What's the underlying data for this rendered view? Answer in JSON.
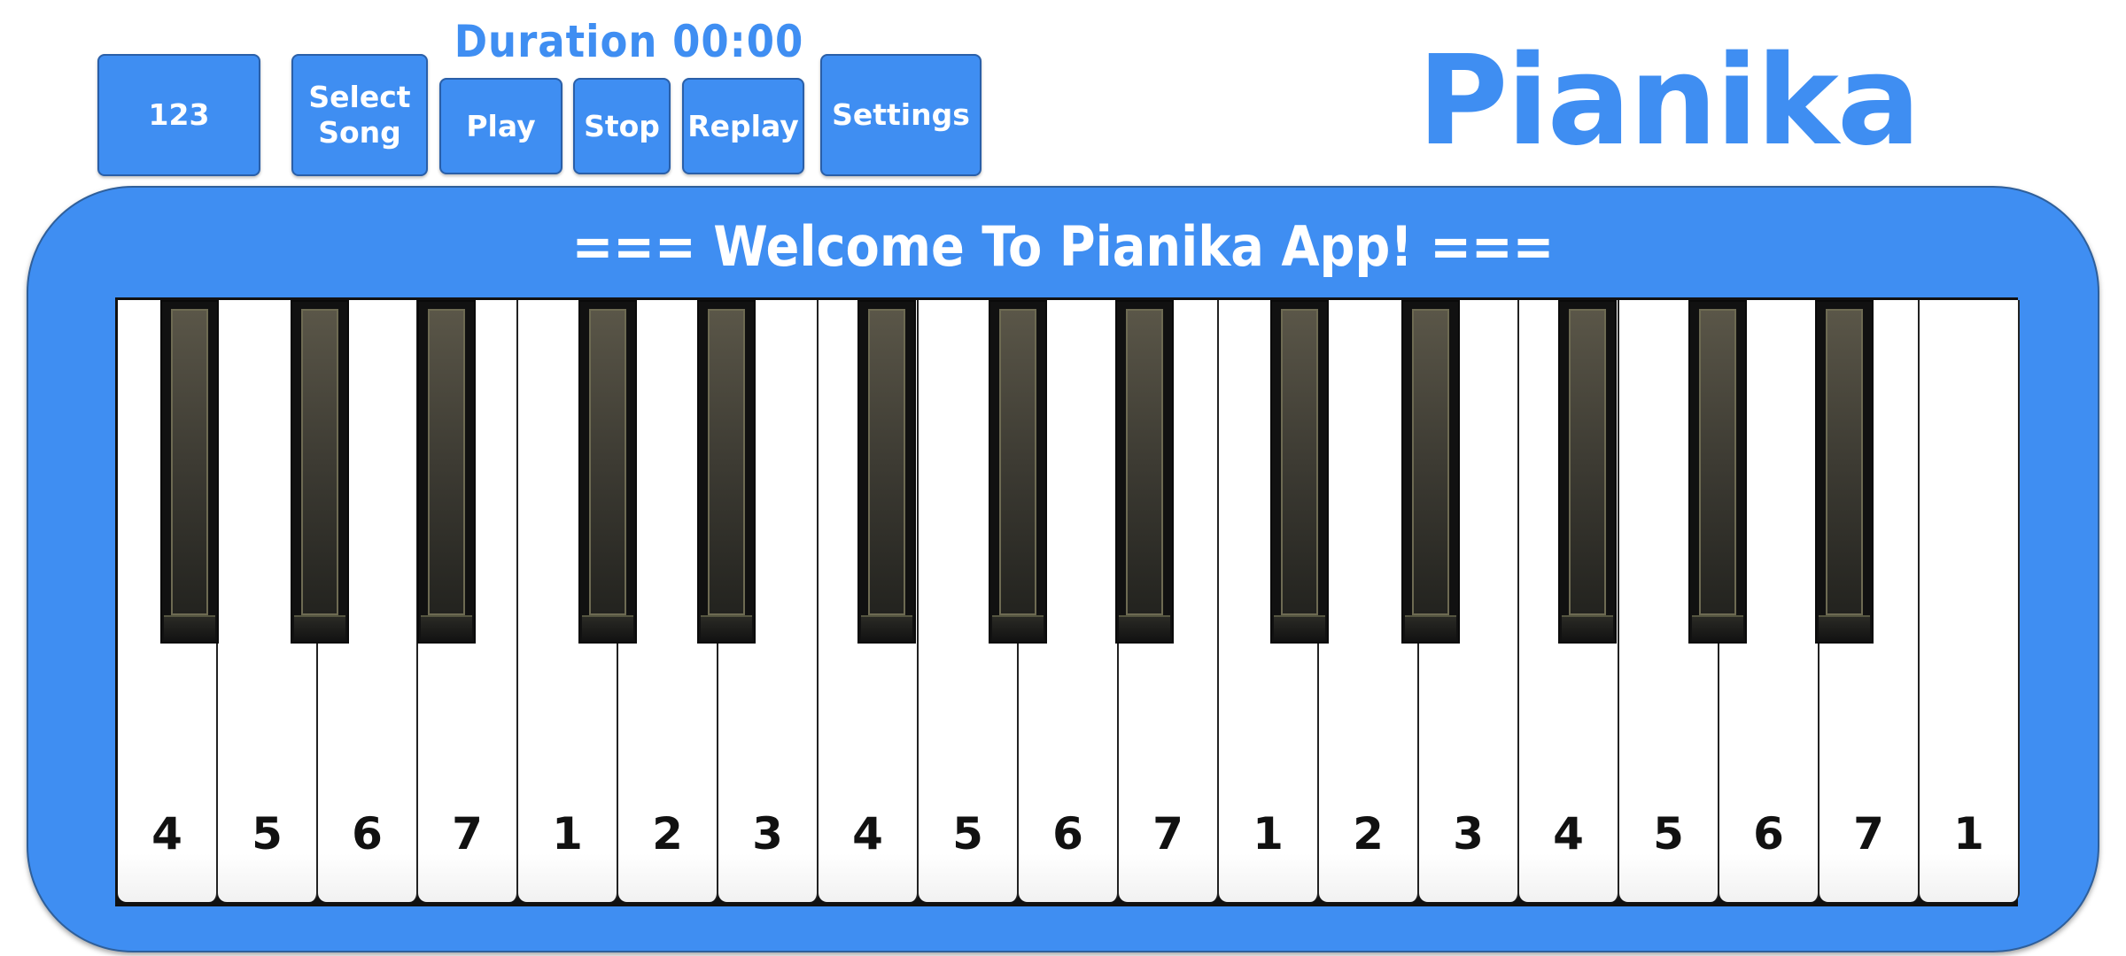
{
  "duration": {
    "label": "Duration 00:00"
  },
  "brand": {
    "title": "Pianika"
  },
  "toolbar": {
    "buttons": [
      {
        "id": "number-mode",
        "lines": [
          "123"
        ]
      },
      {
        "id": "select-song",
        "lines": [
          "Select",
          "Song"
        ]
      },
      {
        "id": "play",
        "lines": [
          "Play"
        ]
      },
      {
        "id": "stop",
        "lines": [
          "Stop"
        ]
      },
      {
        "id": "replay",
        "lines": [
          "Replay"
        ]
      },
      {
        "id": "settings",
        "lines": [
          "Settings"
        ]
      }
    ]
  },
  "keyboard": {
    "welcome": "=== Welcome To Pianika App! ===",
    "white_keys": [
      "4",
      "5",
      "6",
      "7",
      "1",
      "2",
      "3",
      "4",
      "5",
      "6",
      "7",
      "1",
      "2",
      "3",
      "4",
      "5",
      "6",
      "7",
      "1"
    ],
    "black_key_count": 13
  },
  "colors": {
    "accent": "#3f8ef2",
    "button_border": "#2a5fa8",
    "key_white": "#ffffff",
    "key_black": "#111111"
  }
}
